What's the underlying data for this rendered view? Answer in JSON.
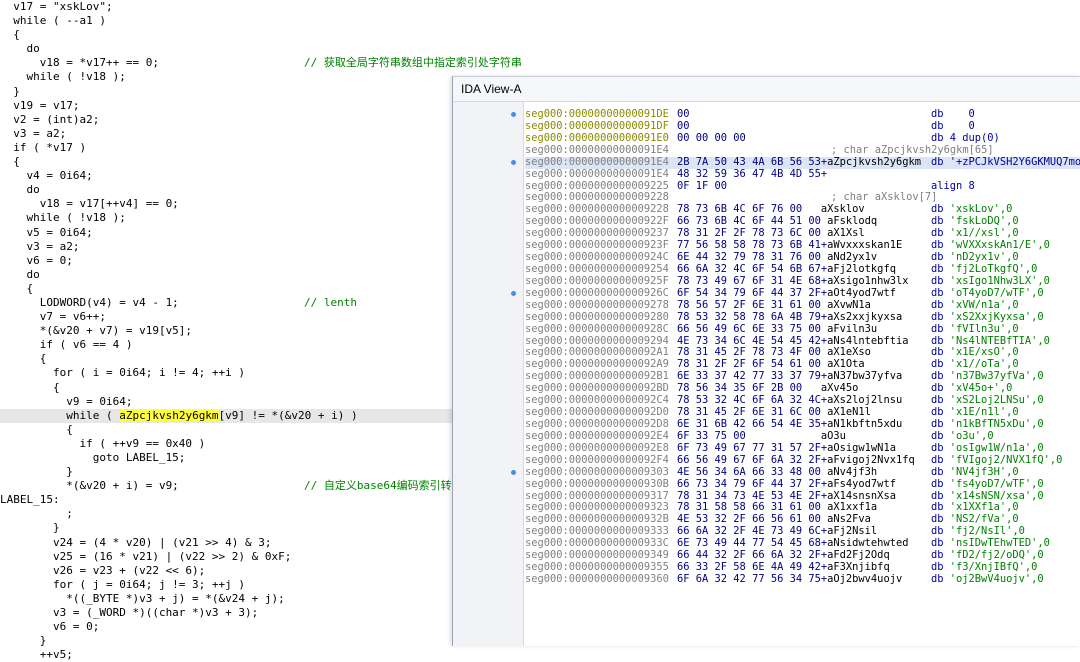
{
  "pseudocode": {
    "lines": [
      {
        "text": "  v17 = \"xskLov\";"
      },
      {
        "text": "  while ( --a1 )"
      },
      {
        "text": "  {"
      },
      {
        "text": "    do"
      },
      {
        "text": "      v18 = *v17++ == 0;",
        "comment": "// 获取全局字符串数组中指定索引处字符串"
      },
      {
        "text": "    while ( !v18 );"
      },
      {
        "text": "  }"
      },
      {
        "text": "  v19 = v17;"
      },
      {
        "text": "  v2 = (int)a2;"
      },
      {
        "text": "  v3 = a2;"
      },
      {
        "text": "  if ( *v17 )"
      },
      {
        "text": "  {"
      },
      {
        "text": "    v4 = 0i64;"
      },
      {
        "text": "    do"
      },
      {
        "text": "      v18 = v17[++v4] == 0;"
      },
      {
        "text": "    while ( !v18 );"
      },
      {
        "text": "    v5 = 0i64;"
      },
      {
        "text": "    v3 = a2;"
      },
      {
        "text": "    v6 = 0;"
      },
      {
        "text": "    do"
      },
      {
        "text": "    {"
      },
      {
        "text": "      LODWORD(v4) = v4 - 1;",
        "comment": "// lenth"
      },
      {
        "text": "      v7 = v6++;"
      },
      {
        "text": "      *(&v20 + v7) = v19[v5];"
      },
      {
        "text": "      if ( v6 == 4 )"
      },
      {
        "text": "      {"
      },
      {
        "text": "        for ( i = 0i64; i != 4; ++i )"
      },
      {
        "text": "        {"
      },
      {
        "text": "          v9 = 0i64;"
      },
      {
        "pre": "          while ( ",
        "word": "aZpcjkvsh2y6gkm",
        "post": "[v9] != *(&v20 + i) )",
        "highlight": true
      },
      {
        "text": "          {"
      },
      {
        "text": "            if ( ++v9 == 0x40 )"
      },
      {
        "text": "              goto LABEL_15;"
      },
      {
        "text": "          }"
      },
      {
        "text": "          *(&v20 + i) = v9;",
        "comment": "// 自定义base64编码索引转"
      },
      {
        "text": "LABEL_15:"
      },
      {
        "text": "          ;"
      },
      {
        "text": "        }"
      },
      {
        "text": "        v24 = (4 * v20) | (v21 >> 4) & 3;"
      },
      {
        "text": "        v25 = (16 * v21) | (v22 >> 2) & 0xF;"
      },
      {
        "text": "        v26 = v23 + (v22 << 6);"
      },
      {
        "text": "        for ( j = 0i64; j != 3; ++j )"
      },
      {
        "text": "          *((_BYTE *)v3 + j) = *(&v24 + j);"
      },
      {
        "text": "        v3 = (_WORD *)((char *)v3 + 3);"
      },
      {
        "text": "        v6 = 0;"
      },
      {
        "text": "      }"
      },
      {
        "text": "      ++v5;"
      }
    ]
  },
  "ida": {
    "title": "IDA View-A",
    "lines": [
      {
        "addr": "seg000:00000000000091DE",
        "hex": "00",
        "dir": "db    0",
        "kind": "code"
      },
      {
        "addr": "seg000:00000000000091DF",
        "hex": "00",
        "dir": "db    0",
        "kind": "code"
      },
      {
        "addr": "seg000:00000000000091E0",
        "hex": "00 00 00 00",
        "dir": "db 4 dup(0)",
        "kind": "code"
      },
      {
        "addr": "seg000:00000000000091E4",
        "cmt": "; char aZpcjkvsh2y6gkm[65]"
      },
      {
        "addr": "seg000:00000000000091E4",
        "hex": "2B 7A 50 43 4A 6B 56 53+",
        "label": "aZpcjkvsh2y6gkm",
        "dir": "db '+zPCJkVSH2Y6GKMUQ7mo",
        "current": true
      },
      {
        "addr": "seg000:00000000000091E4",
        "hex": "48 32 59 36 47 4B 4D 55+"
      },
      {
        "addr": "seg000:0000000000009225",
        "hex": "0F 1F 00",
        "dir": "align 8"
      },
      {
        "addr": "seg000:0000000000009228",
        "cmt": "; char aXsklov[7]"
      },
      {
        "addr": "seg000:0000000000009228",
        "hex": "78 73 6B 4C 6F 76 00",
        "label": "   aXsklov",
        "dir": "db ",
        "str": "'xskLov',0"
      },
      {
        "addr": "seg000:000000000000922F",
        "hex": "66 73 6B 4C 6F 44 51 00",
        "label": " aFsklodq",
        "dir": "db ",
        "str": "'fskLoDQ',0"
      },
      {
        "addr": "seg000:0000000000009237",
        "hex": "78 31 2F 2F 78 73 6C 00",
        "label": " aX1Xsl",
        "dir": "db ",
        "str": "'x1//xsl',0"
      },
      {
        "addr": "seg000:000000000000923F",
        "hex": "77 56 58 58 78 73 6B 41+",
        "label": "aWvxxxskan1E",
        "dir": "db ",
        "str": "'wVXXxskAn1/E',0"
      },
      {
        "addr": "seg000:000000000000924C",
        "hex": "6E 44 32 79 78 31 76 00",
        "label": " aNd2yx1v",
        "dir": "db ",
        "str": "'nD2yx1v',0"
      },
      {
        "addr": "seg000:0000000000009254",
        "hex": "66 6A 32 4C 6F 54 6B 67+",
        "label": "aFj2lotkgfq",
        "dir": "db ",
        "str": "'fj2LoTkgfQ',0"
      },
      {
        "addr": "seg000:000000000000925F",
        "hex": "78 73 49 67 6F 31 4E 68+",
        "label": "aXsigo1nhw3lx",
        "dir": "db ",
        "str": "'xsIgo1Nhw3LX',0"
      },
      {
        "addr": "seg000:000000000000926C",
        "hex": "6F 54 34 79 6F 44 37 2F+",
        "label": "aOt4yod7wtf",
        "dir": "db ",
        "str": "'oT4yoD7/wTF',0"
      },
      {
        "addr": "seg000:0000000000009278",
        "hex": "78 56 57 2F 6E 31 61 00",
        "label": " aXvwN1a",
        "dir": "db ",
        "str": "'xVW/n1a',0"
      },
      {
        "addr": "seg000:0000000000009280",
        "hex": "78 53 32 58 78 6A 4B 79+",
        "label": "aXs2xxjkyxsa",
        "dir": "db ",
        "str": "'xS2XxjKyxsa',0"
      },
      {
        "addr": "seg000:000000000000928C",
        "hex": "66 56 49 6C 6E 33 75 00",
        "label": " aFviln3u",
        "dir": "db ",
        "str": "'fVIln3u',0"
      },
      {
        "addr": "seg000:0000000000009294",
        "hex": "4E 73 34 6C 4E 54 45 42+",
        "label": "aNs4lntebftia",
        "dir": "db ",
        "str": "'Ns4lNTEBfTIA',0"
      },
      {
        "addr": "seg000:00000000000092A1",
        "hex": "78 31 45 2F 78 73 4F 00",
        "label": " aX1eXso",
        "dir": "db ",
        "str": "'x1E/xsO',0"
      },
      {
        "addr": "seg000:00000000000092A9",
        "hex": "78 31 2F 2F 6F 54 61 00",
        "label": " aX1Ota",
        "dir": "db ",
        "str": "'x1//oTa',0"
      },
      {
        "addr": "seg000:00000000000092B1",
        "hex": "6E 33 37 42 77 33 37 79+",
        "label": "aN37bw37yfva",
        "dir": "db ",
        "str": "'n37Bw37yfVa',0"
      },
      {
        "addr": "seg000:00000000000092BD",
        "hex": "78 56 34 35 6F 2B 00",
        "label": "   aXv45o",
        "dir": "db ",
        "str": "'xV45o+',0"
      },
      {
        "addr": "seg000:00000000000092C4",
        "hex": "78 53 32 4C 6F 6A 32 4C+",
        "label": "aXs2loj2lnsu",
        "dir": "db ",
        "str": "'xS2Loj2LNSu',0"
      },
      {
        "addr": "seg000:00000000000092D0",
        "hex": "78 31 45 2F 6E 31 6C 00",
        "label": " aX1eN1l",
        "dir": "db ",
        "str": "'x1E/n1l',0"
      },
      {
        "addr": "seg000:00000000000092D8",
        "hex": "6E 31 6B 42 66 54 4E 35+",
        "label": "aN1kbftn5xdu",
        "dir": "db ",
        "str": "'n1kBfTN5xDu',0"
      },
      {
        "addr": "seg000:00000000000092E4",
        "hex": "6F 33 75 00",
        "label": "            aO3u",
        "dir": "db ",
        "str": "'o3u',0"
      },
      {
        "addr": "seg000:00000000000092E8",
        "hex": "6F 73 49 67 77 31 57 2F+",
        "label": "aOsigw1wN1a",
        "dir": "db ",
        "str": "'osIgw1W/n1a',0"
      },
      {
        "addr": "seg000:00000000000092F4",
        "hex": "66 56 49 67 6F 6A 32 2F+",
        "label": "aFvigoj2Nvx1fq",
        "dir": "db ",
        "str": "'fVIgoj2/NVX1fQ',0"
      },
      {
        "addr": "seg000:0000000000009303",
        "hex": "4E 56 34 6A 66 33 48 00",
        "label": " aNv4jf3h",
        "dir": "db ",
        "str": "'NV4jf3H',0"
      },
      {
        "addr": "seg000:000000000000930B",
        "hex": "66 73 34 79 6F 44 37 2F+",
        "label": "aFs4yod7wtf",
        "dir": "db ",
        "str": "'fs4yoD7/wTF',0"
      },
      {
        "addr": "seg000:0000000000009317",
        "hex": "78 31 34 73 4E 53 4E 2F+",
        "label": "aX14snsnXsa",
        "dir": "db ",
        "str": "'x14sNSN/xsa',0"
      },
      {
        "addr": "seg000:0000000000009323",
        "hex": "78 31 58 58 66 31 61 00",
        "label": " aX1xxf1a",
        "dir": "db ",
        "str": "'x1XXf1a',0"
      },
      {
        "addr": "seg000:000000000000932B",
        "hex": "4E 53 32 2F 66 56 61 00",
        "label": " aNs2Fva",
        "dir": "db ",
        "str": "'NS2/fVa',0"
      },
      {
        "addr": "seg000:0000000000009333",
        "hex": "66 6A 32 2F 4E 73 49 6C+",
        "label": "aFj2Nsil",
        "dir": "db ",
        "str": "'fj2/NsIl',0"
      },
      {
        "addr": "seg000:000000000000933C",
        "hex": "6E 73 49 44 77 54 45 68+",
        "label": "aNsidwtehwted",
        "dir": "db ",
        "str": "'nsIDwTEhwTED',0"
      },
      {
        "addr": "seg000:0000000000009349",
        "hex": "66 44 32 2F 66 6A 32 2F+",
        "label": "aFd2Fj2Odq",
        "dir": "db ",
        "str": "'fD2/fj2/oDQ',0"
      },
      {
        "addr": "seg000:0000000000009355",
        "hex": "66 33 2F 58 6E 4A 49 42+",
        "label": "aF3Xnjibfq",
        "dir": "db ",
        "str": "'f3/XnjIBfQ',0"
      },
      {
        "addr": "seg000:0000000000009360",
        "hex": "6F 6A 32 42 77 56 34 75+",
        "label": "aOj2bwv4uojv",
        "dir": "db ",
        "str": "'oj2BwV4uojv',0"
      }
    ]
  },
  "colors": {
    "highlight": "#ffff3a",
    "comment": "#008000",
    "current_line": "#dbe5f5"
  }
}
